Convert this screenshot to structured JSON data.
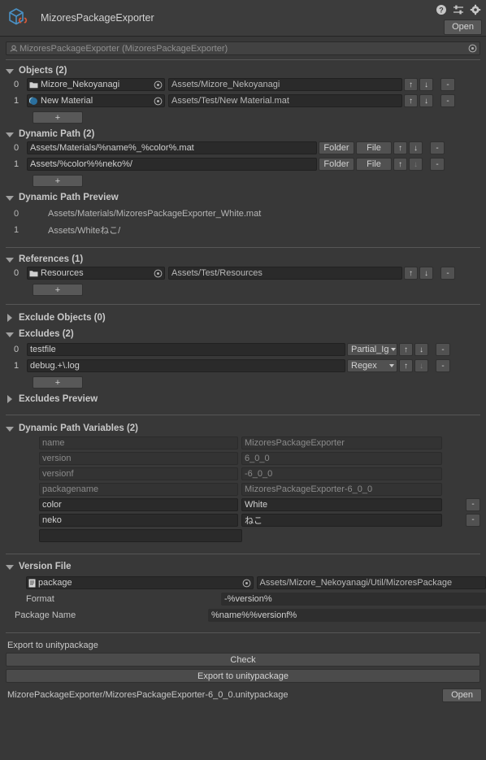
{
  "header": {
    "title": "MizoresPackageExporter",
    "icons": [
      "help-icon",
      "preset-icon",
      "gear-icon"
    ],
    "open_label": "Open"
  },
  "object_header": {
    "text": "MizoresPackageExporter (MizoresPackageExporter)"
  },
  "objects": {
    "title": "Objects (2)",
    "expanded": true,
    "add_label": "+",
    "rows": [
      {
        "index": "0",
        "icon": "folder-icon",
        "name": "Mizore_Nekoyanagi",
        "path": "Assets/Mizore_Nekoyanagi",
        "up": "↑",
        "down": "↓",
        "remove": "-"
      },
      {
        "index": "1",
        "icon": "material-sphere-icon",
        "name": "New Material",
        "path": "Assets/Test/New Material.mat",
        "up": "↑",
        "down": "↓",
        "remove": "-"
      }
    ]
  },
  "dynamic_path": {
    "title": "Dynamic Path (2)",
    "expanded": true,
    "add_label": "+",
    "rows": [
      {
        "index": "0",
        "value": "Assets/Materials/%name%_%color%.mat",
        "folder_label": "Folder",
        "file_label": "File",
        "up": "↑",
        "down": "↓",
        "remove": "-"
      },
      {
        "index": "1",
        "value": "Assets/%color%%neko%/",
        "folder_label": "Folder",
        "file_label": "File",
        "up": "↑",
        "down": "↓",
        "remove": "-"
      }
    ]
  },
  "dynamic_path_preview": {
    "title": "Dynamic Path Preview",
    "expanded": true,
    "rows": [
      {
        "index": "0",
        "value": "Assets/Materials/MizoresPackageExporter_White.mat"
      },
      {
        "index": "1",
        "value": "Assets/Whiteねこ/"
      }
    ]
  },
  "references": {
    "title": "References (1)",
    "expanded": true,
    "add_label": "+",
    "rows": [
      {
        "index": "0",
        "icon": "folder-icon",
        "name": "Resources",
        "path": "Assets/Test/Resources",
        "up": "↑",
        "down": "↓",
        "remove": "-"
      }
    ]
  },
  "exclude_objects": {
    "title": "Exclude Objects (0)",
    "expanded": false
  },
  "excludes": {
    "title": "Excludes (2)",
    "expanded": true,
    "add_label": "+",
    "rows": [
      {
        "index": "0",
        "value": "testfile",
        "mode": "Partial_Ig",
        "up": "↑",
        "down": "↓",
        "remove": "-"
      },
      {
        "index": "1",
        "value": "debug.+\\.log",
        "mode": "Regex",
        "up": "↑",
        "down": "↓",
        "remove": "-"
      }
    ]
  },
  "excludes_preview": {
    "title": "Excludes Preview",
    "expanded": false
  },
  "dynamic_path_variables": {
    "title": "Dynamic Path Variables (2)",
    "expanded": true,
    "rows": [
      {
        "key": "name",
        "value": "MizoresPackageExporter",
        "readonly": true,
        "remove": ""
      },
      {
        "key": "version",
        "value": "6_0_0",
        "readonly": true,
        "remove": ""
      },
      {
        "key": "versionf",
        "value": "-6_0_0",
        "readonly": true,
        "remove": ""
      },
      {
        "key": "packagename",
        "value": "MizoresPackageExporter-6_0_0",
        "readonly": true,
        "remove": ""
      },
      {
        "key": "color",
        "value": "White",
        "readonly": false,
        "remove": "-"
      },
      {
        "key": "neko",
        "value": "ねこ",
        "readonly": false,
        "remove": "-"
      },
      {
        "key": "",
        "value": "",
        "readonly": false,
        "remove": ""
      }
    ]
  },
  "version_file": {
    "title": "Version File",
    "expanded": true,
    "object_icon": "text-asset-icon",
    "object_name": "package",
    "object_path": "Assets/Mizore_Nekoyanagi/Util/MizoresPackage",
    "format_label": "Format",
    "format_value": "-%version%",
    "package_name_label": "Package Name",
    "package_name_value": "%name%%versionf%"
  },
  "export": {
    "title": "Export to unitypackage",
    "check_label": "Check",
    "export_label": "Export to unitypackage",
    "output_path": "MizorePackageExporter/MizoresPackageExporter-6_0_0.unitypackage",
    "open_label": "Open"
  },
  "colors": {
    "background": "#383838",
    "panel": "#3c3c3c",
    "field": "#2a2a2a",
    "button": "#585858",
    "text": "#c4c4c4",
    "accent_blue": "#4a90c4",
    "accent_orange": "#d4593a"
  }
}
